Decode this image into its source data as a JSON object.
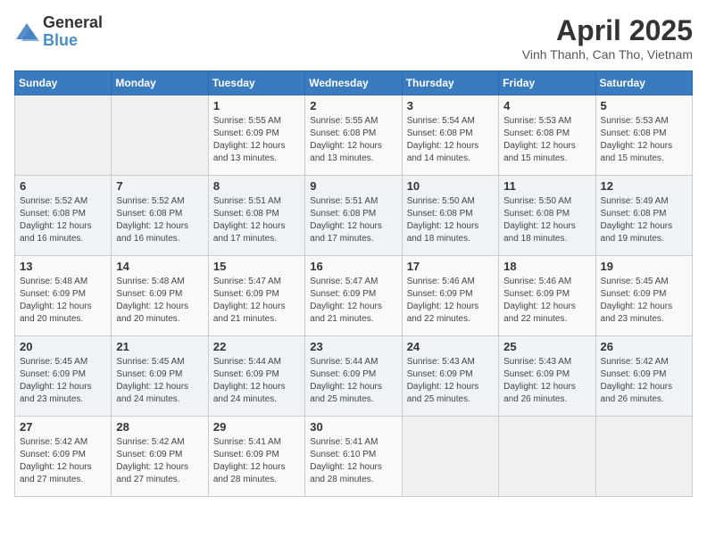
{
  "header": {
    "logo_general": "General",
    "logo_blue": "Blue",
    "month_title": "April 2025",
    "location": "Vinh Thanh, Can Tho, Vietnam"
  },
  "days_of_week": [
    "Sunday",
    "Monday",
    "Tuesday",
    "Wednesday",
    "Thursday",
    "Friday",
    "Saturday"
  ],
  "weeks": [
    [
      {
        "day": "",
        "sunrise": "",
        "sunset": "",
        "daylight": "",
        "empty": true
      },
      {
        "day": "",
        "sunrise": "",
        "sunset": "",
        "daylight": "",
        "empty": true
      },
      {
        "day": "1",
        "sunrise": "Sunrise: 5:55 AM",
        "sunset": "Sunset: 6:09 PM",
        "daylight": "Daylight: 12 hours and 13 minutes."
      },
      {
        "day": "2",
        "sunrise": "Sunrise: 5:55 AM",
        "sunset": "Sunset: 6:08 PM",
        "daylight": "Daylight: 12 hours and 13 minutes."
      },
      {
        "day": "3",
        "sunrise": "Sunrise: 5:54 AM",
        "sunset": "Sunset: 6:08 PM",
        "daylight": "Daylight: 12 hours and 14 minutes."
      },
      {
        "day": "4",
        "sunrise": "Sunrise: 5:53 AM",
        "sunset": "Sunset: 6:08 PM",
        "daylight": "Daylight: 12 hours and 15 minutes."
      },
      {
        "day": "5",
        "sunrise": "Sunrise: 5:53 AM",
        "sunset": "Sunset: 6:08 PM",
        "daylight": "Daylight: 12 hours and 15 minutes."
      }
    ],
    [
      {
        "day": "6",
        "sunrise": "Sunrise: 5:52 AM",
        "sunset": "Sunset: 6:08 PM",
        "daylight": "Daylight: 12 hours and 16 minutes."
      },
      {
        "day": "7",
        "sunrise": "Sunrise: 5:52 AM",
        "sunset": "Sunset: 6:08 PM",
        "daylight": "Daylight: 12 hours and 16 minutes."
      },
      {
        "day": "8",
        "sunrise": "Sunrise: 5:51 AM",
        "sunset": "Sunset: 6:08 PM",
        "daylight": "Daylight: 12 hours and 17 minutes."
      },
      {
        "day": "9",
        "sunrise": "Sunrise: 5:51 AM",
        "sunset": "Sunset: 6:08 PM",
        "daylight": "Daylight: 12 hours and 17 minutes."
      },
      {
        "day": "10",
        "sunrise": "Sunrise: 5:50 AM",
        "sunset": "Sunset: 6:08 PM",
        "daylight": "Daylight: 12 hours and 18 minutes."
      },
      {
        "day": "11",
        "sunrise": "Sunrise: 5:50 AM",
        "sunset": "Sunset: 6:08 PM",
        "daylight": "Daylight: 12 hours and 18 minutes."
      },
      {
        "day": "12",
        "sunrise": "Sunrise: 5:49 AM",
        "sunset": "Sunset: 6:08 PM",
        "daylight": "Daylight: 12 hours and 19 minutes."
      }
    ],
    [
      {
        "day": "13",
        "sunrise": "Sunrise: 5:48 AM",
        "sunset": "Sunset: 6:09 PM",
        "daylight": "Daylight: 12 hours and 20 minutes."
      },
      {
        "day": "14",
        "sunrise": "Sunrise: 5:48 AM",
        "sunset": "Sunset: 6:09 PM",
        "daylight": "Daylight: 12 hours and 20 minutes."
      },
      {
        "day": "15",
        "sunrise": "Sunrise: 5:47 AM",
        "sunset": "Sunset: 6:09 PM",
        "daylight": "Daylight: 12 hours and 21 minutes."
      },
      {
        "day": "16",
        "sunrise": "Sunrise: 5:47 AM",
        "sunset": "Sunset: 6:09 PM",
        "daylight": "Daylight: 12 hours and 21 minutes."
      },
      {
        "day": "17",
        "sunrise": "Sunrise: 5:46 AM",
        "sunset": "Sunset: 6:09 PM",
        "daylight": "Daylight: 12 hours and 22 minutes."
      },
      {
        "day": "18",
        "sunrise": "Sunrise: 5:46 AM",
        "sunset": "Sunset: 6:09 PM",
        "daylight": "Daylight: 12 hours and 22 minutes."
      },
      {
        "day": "19",
        "sunrise": "Sunrise: 5:45 AM",
        "sunset": "Sunset: 6:09 PM",
        "daylight": "Daylight: 12 hours and 23 minutes."
      }
    ],
    [
      {
        "day": "20",
        "sunrise": "Sunrise: 5:45 AM",
        "sunset": "Sunset: 6:09 PM",
        "daylight": "Daylight: 12 hours and 23 minutes."
      },
      {
        "day": "21",
        "sunrise": "Sunrise: 5:45 AM",
        "sunset": "Sunset: 6:09 PM",
        "daylight": "Daylight: 12 hours and 24 minutes."
      },
      {
        "day": "22",
        "sunrise": "Sunrise: 5:44 AM",
        "sunset": "Sunset: 6:09 PM",
        "daylight": "Daylight: 12 hours and 24 minutes."
      },
      {
        "day": "23",
        "sunrise": "Sunrise: 5:44 AM",
        "sunset": "Sunset: 6:09 PM",
        "daylight": "Daylight: 12 hours and 25 minutes."
      },
      {
        "day": "24",
        "sunrise": "Sunrise: 5:43 AM",
        "sunset": "Sunset: 6:09 PM",
        "daylight": "Daylight: 12 hours and 25 minutes."
      },
      {
        "day": "25",
        "sunrise": "Sunrise: 5:43 AM",
        "sunset": "Sunset: 6:09 PM",
        "daylight": "Daylight: 12 hours and 26 minutes."
      },
      {
        "day": "26",
        "sunrise": "Sunrise: 5:42 AM",
        "sunset": "Sunset: 6:09 PM",
        "daylight": "Daylight: 12 hours and 26 minutes."
      }
    ],
    [
      {
        "day": "27",
        "sunrise": "Sunrise: 5:42 AM",
        "sunset": "Sunset: 6:09 PM",
        "daylight": "Daylight: 12 hours and 27 minutes."
      },
      {
        "day": "28",
        "sunrise": "Sunrise: 5:42 AM",
        "sunset": "Sunset: 6:09 PM",
        "daylight": "Daylight: 12 hours and 27 minutes."
      },
      {
        "day": "29",
        "sunrise": "Sunrise: 5:41 AM",
        "sunset": "Sunset: 6:09 PM",
        "daylight": "Daylight: 12 hours and 28 minutes."
      },
      {
        "day": "30",
        "sunrise": "Sunrise: 5:41 AM",
        "sunset": "Sunset: 6:10 PM",
        "daylight": "Daylight: 12 hours and 28 minutes."
      },
      {
        "day": "",
        "sunrise": "",
        "sunset": "",
        "daylight": "",
        "empty": true
      },
      {
        "day": "",
        "sunrise": "",
        "sunset": "",
        "daylight": "",
        "empty": true
      },
      {
        "day": "",
        "sunrise": "",
        "sunset": "",
        "daylight": "",
        "empty": true
      }
    ]
  ]
}
